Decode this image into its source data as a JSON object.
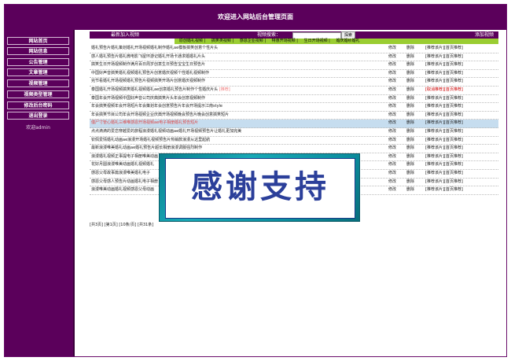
{
  "header": {
    "title": "欢迎进入网站后台管理页面"
  },
  "sidebar": {
    "items": [
      {
        "label": "网站首页"
      },
      {
        "label": "网站信息"
      },
      {
        "label": "公告管理"
      },
      {
        "label": "文章管理"
      },
      {
        "label": "视频管理"
      },
      {
        "label": "视频类型管理"
      },
      {
        "label": "修改后台密码"
      },
      {
        "label": "退出登录"
      }
    ],
    "user": "欢迎admin"
  },
  "toolbar": {
    "new_label": "最新加入视频",
    "search_label": "视频搜索：",
    "search_value": "",
    "search_button": "探索",
    "add_label": "添加视频"
  },
  "categories": [
    "原创婚礼视频",
    "搞笑类视频",
    "感恩企业视频",
    "特惠开场视频",
    "生日开场视频",
    "婚庆婚纱婚礼"
  ],
  "rows": [
    {
      "title": "婚礼预告片婚礼策划婚礼开场视频婚礼制作婚礼ae模板搞笑创意个性片头",
      "tag": "",
      "edit": "修改",
      "del": "删除",
      "rec": "[推荐该片]",
      "top": "[首页推荐]",
      "selected": false,
      "rec_red": false
    },
    {
      "title": "感人婚礼预告片婚礼微电影飞屋环游记婚礼开场卡通求婚婚礼片头",
      "tag": "",
      "edit": "修改",
      "del": "删除",
      "rec": "[推荐该片]",
      "top": "[首页推荐]",
      "selected": false,
      "rec_red": false
    },
    {
      "title": "搞笑生日开场视频制作满月百日周岁创意生日预告宝宝生日预告片",
      "tag": "",
      "edit": "修改",
      "del": "删除",
      "rec": "[推荐该片]",
      "top": "[首页推荐]",
      "selected": false,
      "rec_red": false
    },
    {
      "title": "中国好声音搞笑婚礼视频婚礼预告片创意婚庆视频个性婚礼视频制作",
      "tag": "",
      "edit": "修改",
      "del": "删除",
      "rec": "[推荐该片]",
      "top": "[首页推荐]",
      "selected": false,
      "rec_red": false
    },
    {
      "title": "完节看婚礼开场视频婚礼预告片视频搞笑开场片创意婚庆视频制作",
      "tag": "",
      "edit": "修改",
      "del": "删除",
      "rec": "[推荐该片]",
      "top": "[首页推荐]",
      "selected": false,
      "rec_red": false
    },
    {
      "title": "泰国婚礼开场视频搞笑婚礼视频婚礼ae创意婚礼预告片制作个性婚庆片头",
      "tag": "[推荐]",
      "edit": "修改",
      "del": "删除",
      "rec": "[取消推荐]",
      "top": "[首页推荐]",
      "selected": false,
      "rec_red": true
    },
    {
      "title": "泰国年会开场视频中国好声音公司庆典搞笑片头年会创意视频制作",
      "tag": "",
      "edit": "修改",
      "del": "删除",
      "rec": "[推荐该片]",
      "top": "[首页推荐]",
      "selected": false,
      "rec_red": false
    },
    {
      "title": "年会搞笑视频年会开场短片年会策划年会创意预告片年会开场提示江南style",
      "tag": "",
      "edit": "修改",
      "del": "删除",
      "rec": "[推荐该片]",
      "top": "[首页推荐]",
      "selected": false,
      "rec_red": false
    },
    {
      "title": "年会搞笑节目公司年会开场视频企业庆典开场视频晚会预告片晚会创意搞笑短片",
      "tag": "",
      "edit": "修改",
      "del": "删除",
      "rec": "[推荐该片]",
      "top": "[首页推荐]",
      "selected": false,
      "rec_red": false
    },
    {
      "title": "僵尸寸管心婚礼三维唯感恩开场视频ae电子相册婚礼预告短片",
      "tag": "",
      "edit": "修改",
      "del": "删除",
      "rec": "[推荐该片]",
      "top": "[首页推荐]",
      "selected": true,
      "rec_red": false
    },
    {
      "title": "点点滴滴的爱恋穿越爱的旅程浪漫婚礼视频动画ae婚礼开场视频预告片让婚礼更加完美",
      "tag": "",
      "edit": "修改",
      "del": "删除",
      "rec": "[推荐该片]",
      "top": "[首页推荐]",
      "selected": false,
      "rec_red": false
    },
    {
      "title": "钦佩爱情婚礼动画ae浪漫开场婚礼视频预告片热销款浪漫从这里起航",
      "tag": "",
      "edit": "修改",
      "del": "删除",
      "rec": "[推荐该片]",
      "top": "[首页推荐]",
      "selected": false,
      "rec_red": false
    },
    {
      "title": "最新浪漫唯美婚礼动画ae婚礼预告片超长相册浪漫调服强烈制作",
      "tag": "",
      "edit": "修改",
      "del": "删除",
      "rec": "[推荐该片]",
      "top": "[首页推荐]",
      "selected": false,
      "rec_red": false
    },
    {
      "title": "浪漫婚礼视频正事提电子相册唯美动画",
      "tag": "",
      "edit": "修改",
      "del": "删除",
      "rec": "[推荐该片]",
      "top": "[首页推荐]",
      "selected": false,
      "rec_red": false
    },
    {
      "title": "花好月圆浪漫唯美动画婚礼视频婚礼",
      "tag": "",
      "edit": "修改",
      "del": "删除",
      "rec": "[推荐该片]",
      "top": "[首页推荐]",
      "selected": false,
      "rec_red": false
    },
    {
      "title": "感恩父母故事篇浪漫唯美婚礼电子",
      "tag": "",
      "edit": "修改",
      "del": "删除",
      "rec": "[推荐该片]",
      "top": "[首页推荐]",
      "selected": false,
      "rec_red": false
    },
    {
      "title": "感恩父母感人预告片动画婚礼电子相册",
      "tag": "",
      "edit": "修改",
      "del": "删除",
      "rec": "[推荐该片]",
      "top": "[首页推荐]",
      "selected": false,
      "rec_red": false
    },
    {
      "title": "浪漫唯美动画婚礼视频感恩父母动画",
      "tag": "",
      "edit": "修改",
      "del": "删除",
      "rec": "[推荐该片]",
      "top": "[首页推荐]",
      "selected": false,
      "rec_red": false
    }
  ],
  "pager": {
    "text": "[共3页] [第1页] [10条/页] [共31条]"
  },
  "overlay": {
    "text": "感谢支持"
  }
}
